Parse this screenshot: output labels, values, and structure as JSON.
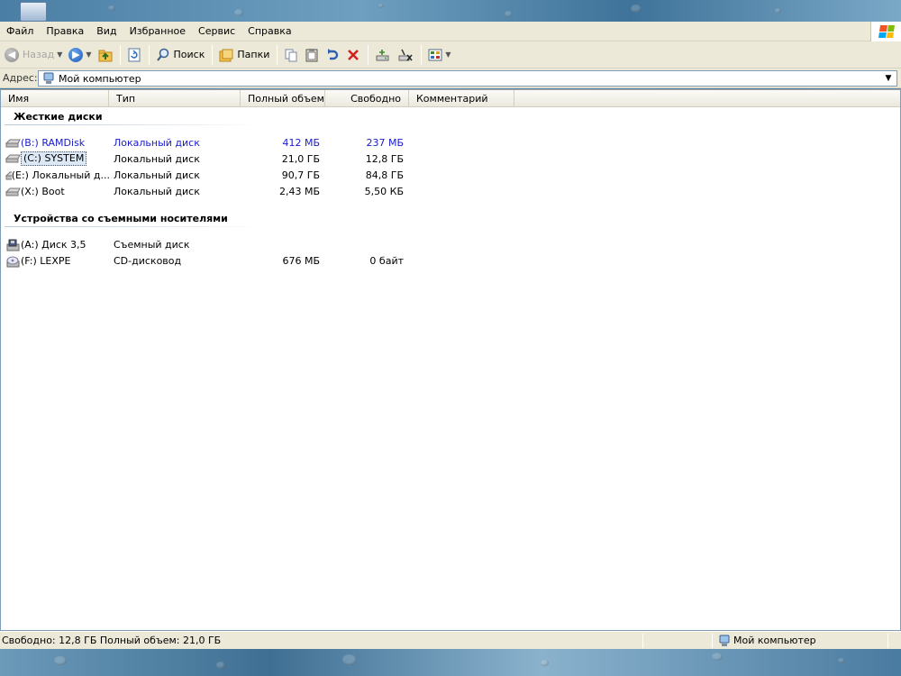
{
  "menubar": {
    "items": [
      "Файл",
      "Правка",
      "Вид",
      "Избранное",
      "Сервис",
      "Справка"
    ]
  },
  "toolbar": {
    "back_label": "Назад",
    "search_label": "Поиск",
    "folders_label": "Папки"
  },
  "address": {
    "label": "Адрес:",
    "value": "Мой компьютер"
  },
  "columns": [
    "Имя",
    "Тип",
    "Полный объем",
    "Свободно",
    "Комментарий"
  ],
  "groups": [
    {
      "title": "Жесткие диски",
      "items": [
        {
          "name": "(B:) RAMDisk",
          "type": "Локальный диск",
          "total": "412 МБ",
          "free": "237 МБ",
          "highlight": true,
          "icon": "hard-drive-icon"
        },
        {
          "name": "(C:) SYSTEM",
          "type": "Локальный диск",
          "total": "21,0 ГБ",
          "free": "12,8 ГБ",
          "selected": true,
          "icon": "hard-drive-icon"
        },
        {
          "name": "(E:) Локальный д...",
          "type": "Локальный диск",
          "total": "90,7 ГБ",
          "free": "84,8 ГБ",
          "icon": "hard-drive-icon"
        },
        {
          "name": "(X:) Boot",
          "type": "Локальный диск",
          "total": "2,43 МБ",
          "free": "5,50 КБ",
          "icon": "hard-drive-icon"
        }
      ]
    },
    {
      "title": "Устройства со съемными носителями",
      "items": [
        {
          "name": "(A:) Диск 3,5",
          "type": "Съемный диск",
          "total": "",
          "free": "",
          "icon": "floppy-drive-icon"
        },
        {
          "name": "(F:) LEXPE",
          "type": "CD-дисковод",
          "total": "676 МБ",
          "free": "0 байт",
          "icon": "cd-drive-icon"
        }
      ]
    }
  ],
  "status": {
    "left": "Свободно: 12,8 ГБ Полный объем: 21,0 ГБ",
    "right": "Мой компьютер"
  },
  "colors": {
    "chrome": "#ece9d8",
    "highlight_text": "#1a1acd",
    "selection_bg": "#dce8f6"
  }
}
